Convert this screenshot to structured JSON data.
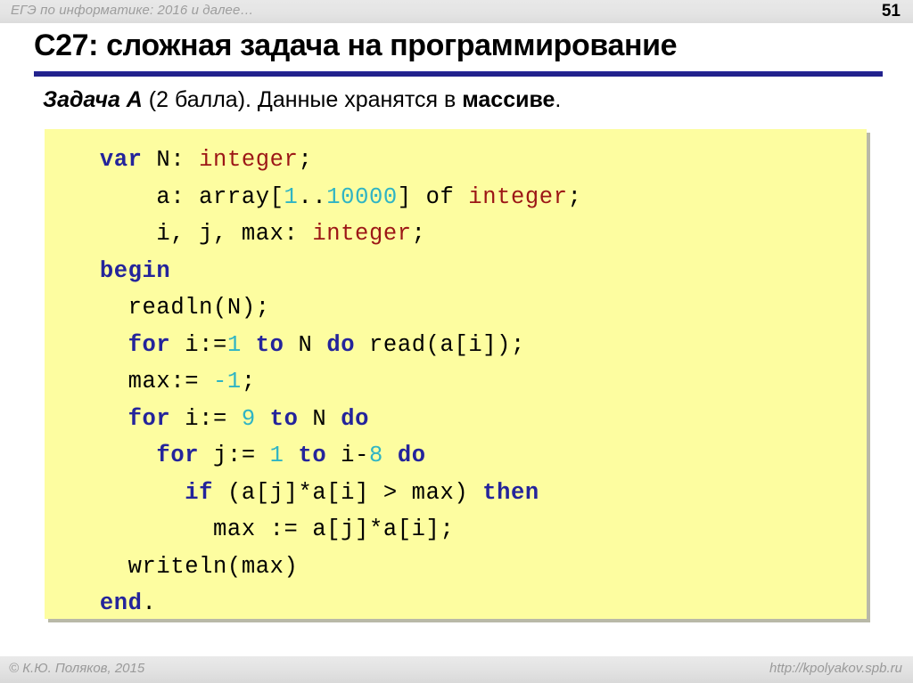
{
  "header": {
    "title": "ЕГЭ по информатике: 2016 и далее…",
    "page_number": "51"
  },
  "slide": {
    "title": "C27: сложная задача на программирование",
    "rule_color": "#22228c",
    "subtitle": {
      "task_label": "Задача A",
      "middle": " (2 балла). Данные хранятся в ",
      "strong": "массиве",
      "tail": "."
    }
  },
  "code": {
    "background": "#fdfda0",
    "colors": {
      "keyword": "#24249b",
      "type": "#9c1616",
      "number": "#2fb4c4",
      "plain": "#000000"
    },
    "lines": [
      [
        {
          "t": "  ",
          "c": "pln"
        },
        {
          "t": "var",
          "c": "kw"
        },
        {
          "t": " N: ",
          "c": "pln"
        },
        {
          "t": "integer",
          "c": "typ"
        },
        {
          "t": ";",
          "c": "pln"
        }
      ],
      [
        {
          "t": "      a: array[",
          "c": "pln"
        },
        {
          "t": "1",
          "c": "num"
        },
        {
          "t": "..",
          "c": "pln"
        },
        {
          "t": "10000",
          "c": "num"
        },
        {
          "t": "] of ",
          "c": "pln"
        },
        {
          "t": "integer",
          "c": "typ"
        },
        {
          "t": ";",
          "c": "pln"
        }
      ],
      [
        {
          "t": "      i, j, max: ",
          "c": "pln"
        },
        {
          "t": "integer",
          "c": "typ"
        },
        {
          "t": ";",
          "c": "pln"
        }
      ],
      [
        {
          "t": "  ",
          "c": "pln"
        },
        {
          "t": "begin",
          "c": "kw"
        }
      ],
      [
        {
          "t": "    readln(N);",
          "c": "pln"
        }
      ],
      [
        {
          "t": "    ",
          "c": "pln"
        },
        {
          "t": "for",
          "c": "kw"
        },
        {
          "t": " i:=",
          "c": "pln"
        },
        {
          "t": "1",
          "c": "num"
        },
        {
          "t": " ",
          "c": "pln"
        },
        {
          "t": "to",
          "c": "kw"
        },
        {
          "t": " N ",
          "c": "pln"
        },
        {
          "t": "do",
          "c": "kw"
        },
        {
          "t": " read(a[i]);",
          "c": "pln"
        }
      ],
      [
        {
          "t": "    max:= ",
          "c": "pln"
        },
        {
          "t": "-1",
          "c": "num"
        },
        {
          "t": ";",
          "c": "pln"
        }
      ],
      [
        {
          "t": "    ",
          "c": "pln"
        },
        {
          "t": "for",
          "c": "kw"
        },
        {
          "t": " i:= ",
          "c": "pln"
        },
        {
          "t": "9",
          "c": "num"
        },
        {
          "t": " ",
          "c": "pln"
        },
        {
          "t": "to",
          "c": "kw"
        },
        {
          "t": " N ",
          "c": "pln"
        },
        {
          "t": "do",
          "c": "kw"
        }
      ],
      [
        {
          "t": "      ",
          "c": "pln"
        },
        {
          "t": "for",
          "c": "kw"
        },
        {
          "t": " j:= ",
          "c": "pln"
        },
        {
          "t": "1",
          "c": "num"
        },
        {
          "t": " ",
          "c": "pln"
        },
        {
          "t": "to",
          "c": "kw"
        },
        {
          "t": " i-",
          "c": "pln"
        },
        {
          "t": "8",
          "c": "num"
        },
        {
          "t": " ",
          "c": "pln"
        },
        {
          "t": "do",
          "c": "kw"
        }
      ],
      [
        {
          "t": "        ",
          "c": "pln"
        },
        {
          "t": "if",
          "c": "kw"
        },
        {
          "t": " (a[j]*a[i] > max) ",
          "c": "pln"
        },
        {
          "t": "then",
          "c": "kw"
        }
      ],
      [
        {
          "t": "          max := a[j]*a[i];",
          "c": "pln"
        }
      ],
      [
        {
          "t": "    writeln(max)",
          "c": "pln"
        }
      ],
      [
        {
          "t": "  ",
          "c": "pln"
        },
        {
          "t": "end",
          "c": "kw"
        },
        {
          "t": ".",
          "c": "pln"
        }
      ]
    ]
  },
  "footer": {
    "copyright": "© К.Ю. Поляков, 2015",
    "url": "http://kpolyakov.spb.ru"
  }
}
